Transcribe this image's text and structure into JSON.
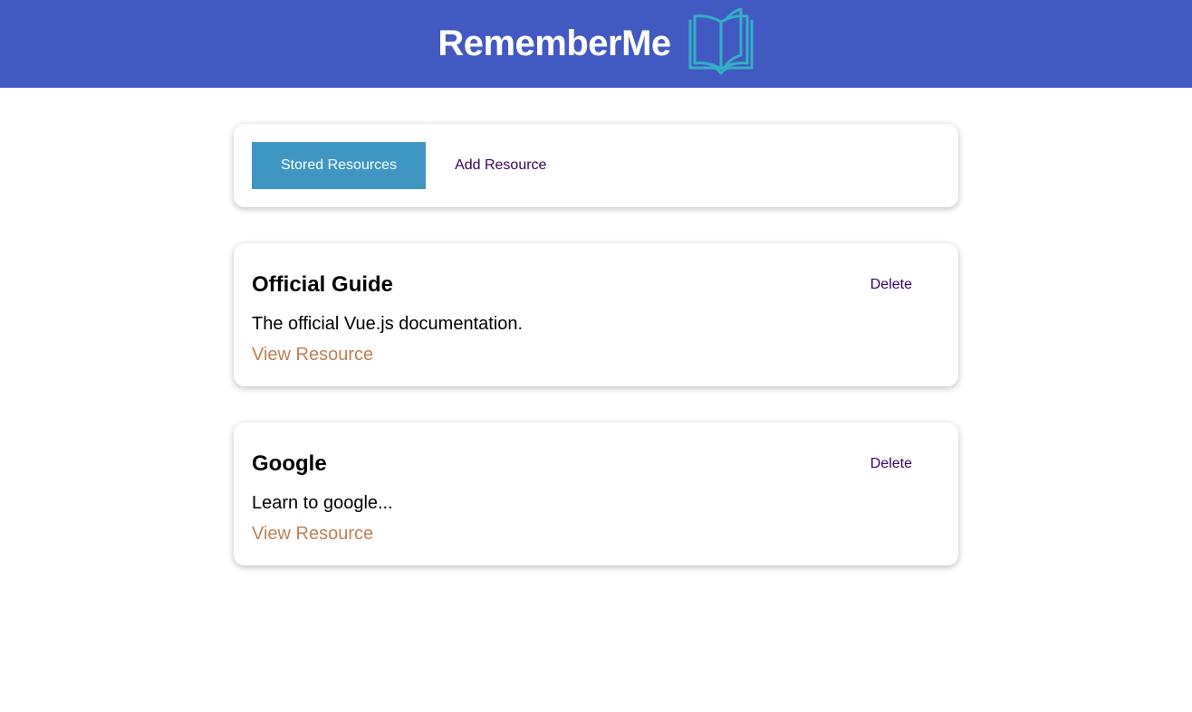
{
  "header": {
    "title": "RememberMe",
    "logo_icon": "open-book-icon",
    "background_color": "#4259c1",
    "logo_color": "#34b0c5"
  },
  "nav": {
    "tabs": [
      {
        "label": "Stored Resources",
        "active": true
      },
      {
        "label": "Add Resource",
        "active": false
      }
    ],
    "active_color": "#3f96c2"
  },
  "resources": [
    {
      "title": "Official Guide",
      "description": "The official Vue.js documentation.",
      "link_label": "View Resource",
      "delete_label": "Delete"
    },
    {
      "title": "Google",
      "description": "Learn to google...",
      "link_label": "View Resource",
      "delete_label": "Delete"
    }
  ],
  "colors": {
    "link": "#ba8054",
    "button_text": "#3a0061"
  }
}
